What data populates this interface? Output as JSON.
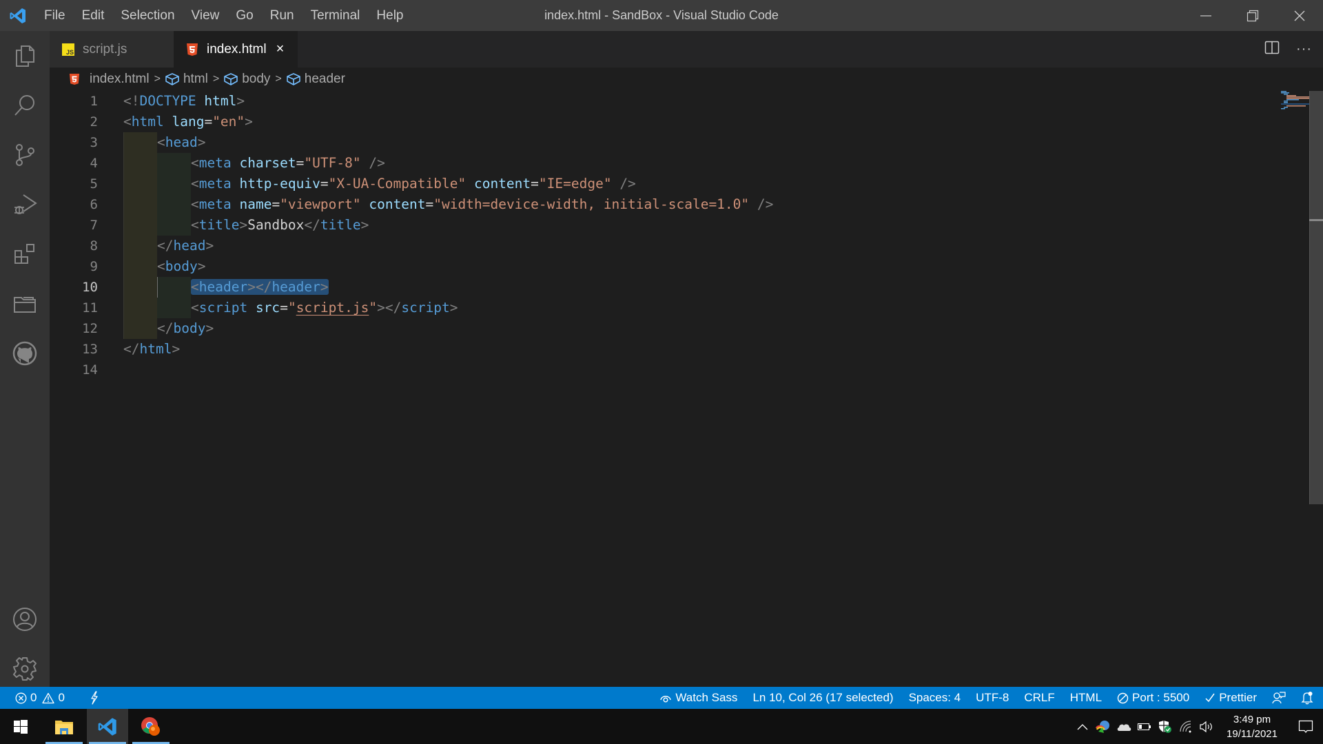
{
  "window": {
    "title": "index.html - SandBox - Visual Studio Code",
    "menu": [
      "File",
      "Edit",
      "Selection",
      "View",
      "Go",
      "Run",
      "Terminal",
      "Help"
    ],
    "controls": {
      "minimize": "minimize-icon",
      "restore": "restore-icon",
      "close": "close-icon"
    }
  },
  "activity_bar": {
    "top": [
      "explorer-icon",
      "search-icon",
      "source-control-icon",
      "run-debug-icon",
      "extensions-icon",
      "folder-icon",
      "github-icon"
    ],
    "bottom": [
      "account-icon",
      "settings-gear-icon"
    ]
  },
  "tabs": [
    {
      "label": "script.js",
      "icon": "js-file-icon",
      "active": false
    },
    {
      "label": "index.html",
      "icon": "html5-file-icon",
      "active": true,
      "close": "×"
    }
  ],
  "editor_actions": {
    "split": "split-editor-icon",
    "more": "···"
  },
  "breadcrumbs": [
    {
      "label": "index.html",
      "icon": "html5-file-icon"
    },
    {
      "label": "html",
      "icon": "symbol-cube-icon"
    },
    {
      "label": "body",
      "icon": "symbol-cube-icon"
    },
    {
      "label": "header",
      "icon": "symbol-cube-icon"
    }
  ],
  "editor": {
    "current_line": 10,
    "line_numbers": [
      "1",
      "2",
      "3",
      "4",
      "5",
      "6",
      "7",
      "8",
      "9",
      "10",
      "11",
      "12",
      "13",
      "14"
    ],
    "code": {
      "l1": {
        "open": "<!",
        "doctype": "DOCTYPE",
        "sp": " ",
        "attr": "html",
        "close": ">"
      },
      "l2": {
        "open": "<",
        "tag": "html",
        "attr": "lang",
        "eq": "=",
        "val": "\"en\"",
        "close": ">"
      },
      "l3": {
        "open": "<",
        "tag": "head",
        "close": ">"
      },
      "l4": {
        "open": "<",
        "tag": "meta",
        "attr": "charset",
        "eq": "=",
        "val": "\"UTF-8\"",
        "close": " />"
      },
      "l5": {
        "open": "<",
        "tag": "meta",
        "attr1": "http-equiv",
        "val1": "\"X-UA-Compatible\"",
        "attr2": "content",
        "val2": "\"IE=edge\"",
        "close": " />"
      },
      "l6": {
        "open": "<",
        "tag": "meta",
        "attr1": "name",
        "val1": "\"viewport\"",
        "attr2": "content",
        "val2": "\"width=device-width, initial-scale=1.0\"",
        "close": " />"
      },
      "l7": {
        "open": "<",
        "tag": "title",
        "mid": ">",
        "text": "Sandbox",
        "open2": "</",
        "tag2": "title",
        "close": ">"
      },
      "l8": {
        "open": "</",
        "tag": "head",
        "close": ">"
      },
      "l9": {
        "open": "<",
        "tag": "body",
        "close": ">"
      },
      "l10": {
        "open": "<",
        "tag": "header",
        "mid": "></",
        "tag2": "header",
        "close": ">"
      },
      "l11": {
        "open": "<",
        "tag": "script",
        "attr": "src",
        "eq": "=",
        "q1": "\"",
        "link": "script.js",
        "q2": "\"",
        "mid": "></",
        "tag2": "script",
        "close": ">"
      },
      "l12": {
        "open": "</",
        "tag": "body",
        "close": ">"
      },
      "l13": {
        "open": "</",
        "tag": "html",
        "close": ">"
      }
    }
  },
  "status_bar": {
    "errors": "0",
    "warnings": "0",
    "watch_sass": "Watch Sass",
    "cursor": "Ln 10, Col 26 (17 selected)",
    "spaces": "Spaces: 4",
    "encoding": "UTF-8",
    "eol": "CRLF",
    "language": "HTML",
    "port": "Port : 5500",
    "prettier": "Prettier",
    "colors": {
      "background": "#007acc"
    }
  },
  "taskbar": {
    "apps": [
      "windows-start-icon",
      "file-explorer-icon",
      "vscode-icon",
      "chrome-icon"
    ],
    "time": "3:49 pm",
    "date": "19/11/2021"
  }
}
